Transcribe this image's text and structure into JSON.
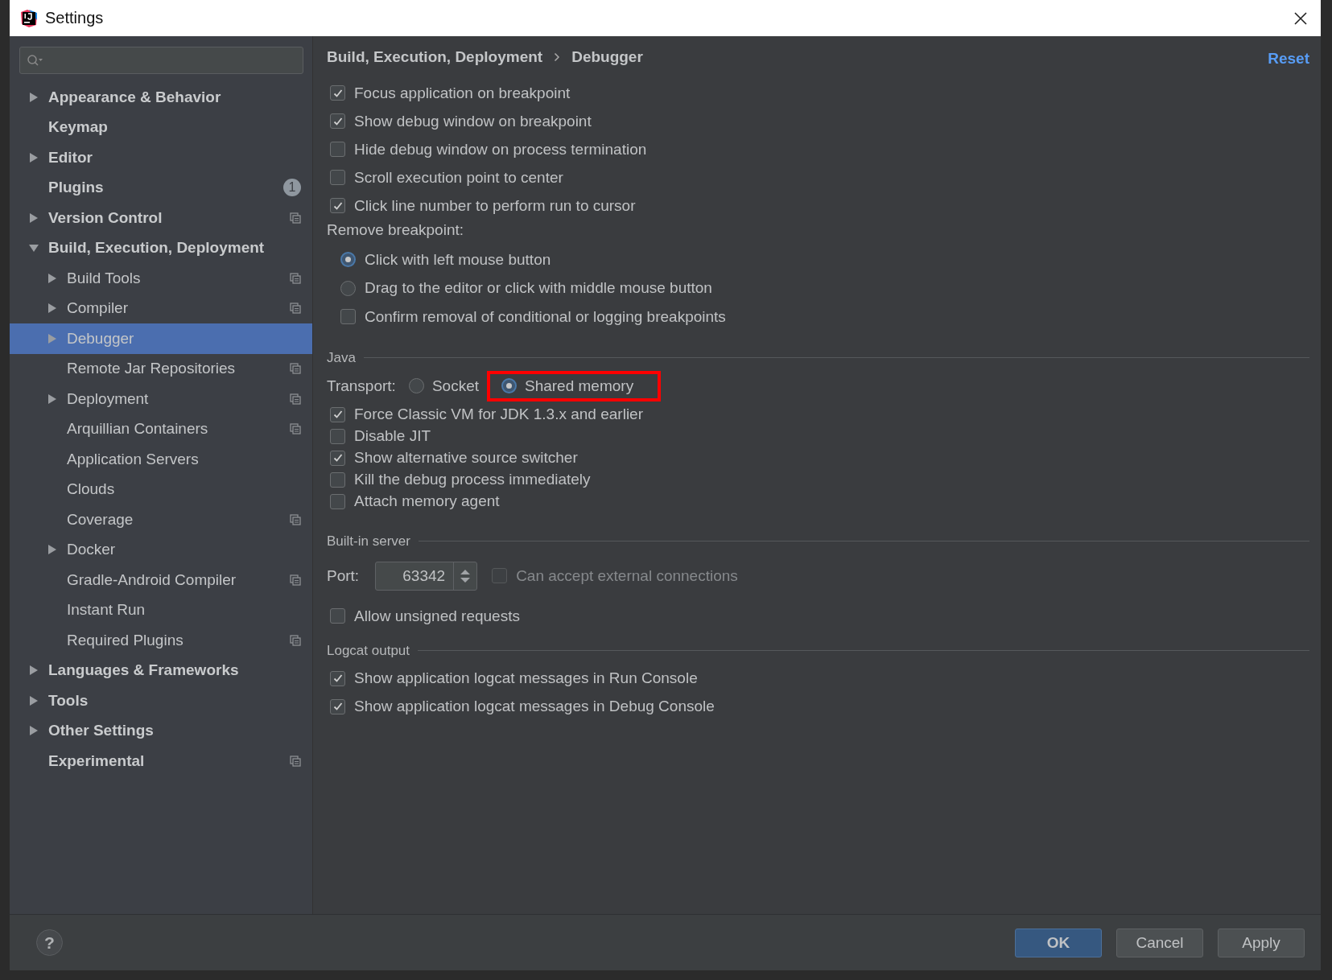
{
  "window": {
    "title": "Settings"
  },
  "sidebar": {
    "items": [
      {
        "label": "Appearance & Behavior",
        "expanded": false,
        "selected": false
      },
      {
        "label": "Keymap",
        "selected": false
      },
      {
        "label": "Editor",
        "expanded": false,
        "selected": false
      },
      {
        "label": "Plugins",
        "badge": "1",
        "selected": false
      },
      {
        "label": "Version Control",
        "expanded": false,
        "project_level": true,
        "selected": false
      },
      {
        "label": "Build, Execution, Deployment",
        "expanded": true,
        "selected": false,
        "children": [
          {
            "label": "Build Tools",
            "expanded": false,
            "project_level": true,
            "selected": false
          },
          {
            "label": "Compiler",
            "expanded": false,
            "project_level": true,
            "selected": false
          },
          {
            "label": "Debugger",
            "expanded": false,
            "selected": true
          },
          {
            "label": "Remote Jar Repositories",
            "project_level": true,
            "selected": false
          },
          {
            "label": "Deployment",
            "expanded": false,
            "project_level": true,
            "selected": false
          },
          {
            "label": "Arquillian Containers",
            "project_level": true,
            "selected": false
          },
          {
            "label": "Application Servers",
            "selected": false
          },
          {
            "label": "Clouds",
            "selected": false
          },
          {
            "label": "Coverage",
            "project_level": true,
            "selected": false
          },
          {
            "label": "Docker",
            "expanded": false,
            "selected": false
          },
          {
            "label": "Gradle-Android Compiler",
            "project_level": true,
            "selected": false
          },
          {
            "label": "Instant Run",
            "selected": false
          },
          {
            "label": "Required Plugins",
            "project_level": true,
            "selected": false
          }
        ]
      },
      {
        "label": "Languages & Frameworks",
        "expanded": false,
        "selected": false
      },
      {
        "label": "Tools",
        "expanded": false,
        "selected": false
      },
      {
        "label": "Other Settings",
        "expanded": false,
        "selected": false
      },
      {
        "label": "Experimental",
        "project_level": true,
        "selected": false
      }
    ]
  },
  "breadcrumb": [
    "Build, Execution, Deployment",
    "Debugger"
  ],
  "reset": "Reset",
  "options": [
    {
      "label": "Focus application on breakpoint",
      "checked": true
    },
    {
      "label": "Show debug window on breakpoint",
      "checked": true
    },
    {
      "label": "Hide debug window on process termination",
      "checked": false
    },
    {
      "label": "Scroll execution point to center",
      "checked": false
    },
    {
      "label": "Click line number to perform run to cursor",
      "checked": true
    }
  ],
  "remove_breakpoint": {
    "label": "Remove breakpoint:",
    "items": [
      {
        "kind": "radio",
        "label": "Click with left mouse button",
        "selected": true
      },
      {
        "kind": "radio",
        "label": "Drag to the editor or click with middle mouse button",
        "selected": false
      },
      {
        "kind": "checkbox",
        "label": "Confirm removal of conditional or logging breakpoints",
        "checked": false
      }
    ]
  },
  "java": {
    "title": "Java",
    "transport_label": "Transport:",
    "transport": [
      {
        "label": "Socket",
        "selected": false,
        "highlighted": false
      },
      {
        "label": "Shared memory",
        "selected": true,
        "highlighted": true
      }
    ],
    "options": [
      {
        "label": "Force Classic VM for JDK 1.3.x and earlier",
        "checked": true
      },
      {
        "label": "Disable JIT",
        "checked": false
      },
      {
        "label": "Show alternative source switcher",
        "checked": true
      },
      {
        "label": "Kill the debug process immediately",
        "checked": false
      },
      {
        "label": "Attach memory agent",
        "checked": false
      }
    ]
  },
  "server": {
    "title": "Built-in server",
    "port_label": "Port:",
    "port": "63342",
    "external": {
      "label": "Can accept external connections",
      "checked": false,
      "disabled": true
    },
    "unsigned": {
      "label": "Allow unsigned requests",
      "checked": false
    }
  },
  "logcat": {
    "title": "Logcat output",
    "options": [
      {
        "label": "Show application logcat messages in Run Console",
        "checked": true
      },
      {
        "label": "Show application logcat messages in Debug Console",
        "checked": true
      }
    ]
  },
  "help": "?",
  "buttons": [
    {
      "label": "OK",
      "primary": true
    },
    {
      "label": "Cancel",
      "primary": false
    },
    {
      "label": "Apply",
      "primary": false
    }
  ]
}
